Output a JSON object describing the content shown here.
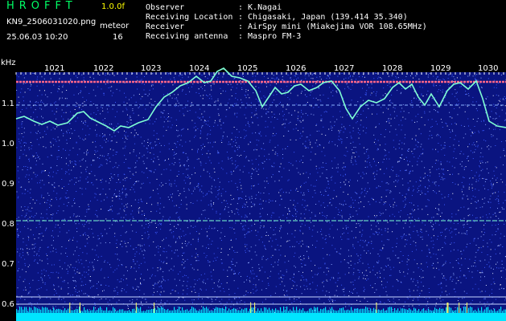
{
  "header": {
    "app_title": "HROFFT",
    "version": "1.0.0f",
    "filename": "KN9_2506031020.png",
    "mode": "meteor",
    "datetime": "25.06.03 10:20",
    "count": "16"
  },
  "info": [
    {
      "label": "Observer",
      "value": ": K.Nagai"
    },
    {
      "label": "Receiving Location",
      "value": ": Chigasaki, Japan (139.414 35.340)"
    },
    {
      "label": "Receiver",
      "value": ": AirSpy mini (Miakejima VOR 108.65MHz)"
    },
    {
      "label": "Receiving antenna",
      "value": ": Maspro FM-3"
    }
  ],
  "axis": {
    "unit": "kHz",
    "y_ticks": [
      "1.1",
      "1.0",
      "0.9",
      "0.8",
      "0.7",
      "0.6"
    ],
    "x_ticks": [
      "1021",
      "1022",
      "1023",
      "1024",
      "1025",
      "1026",
      "1027",
      "1028",
      "1029",
      "1030"
    ]
  },
  "colors": {
    "background": "#000000",
    "noise_bg": "#0a1480",
    "trace": "#7fffd4",
    "title": "#00ff66",
    "version": "#ffff00",
    "carrier": "#ff6688",
    "baseline": "#00e5ff"
  }
}
